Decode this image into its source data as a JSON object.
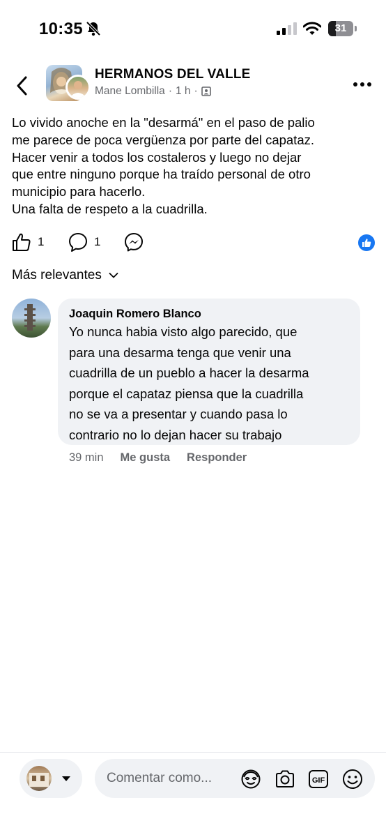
{
  "status_bar": {
    "time": "10:35",
    "battery": "31",
    "battery_fraction": 0.31
  },
  "header": {
    "group_name": "HERMANOS DEL VALLE",
    "author": "Mane Lombilla",
    "separator": "·",
    "time": "1 h"
  },
  "post": {
    "text": "Lo vivido anoche en la \"desarmá\" en el paso de palio\nme parece de poca vergüenza por parte del capataz.\nHacer venir a todos los costaleros y luego no dejar\nque entre ninguno porque ha traído personal de otro\nmunicipio para hacerlo.\nUna falta de respeto a la cuadrilla."
  },
  "actions": {
    "like_count": "1",
    "comment_count": "1"
  },
  "sort": {
    "label": "Más relevantes"
  },
  "comment": {
    "author": "Joaquin Romero Blanco",
    "text": "Yo nunca habia visto algo parecido, que\npara una desarma tenga que venir una\ncuadrilla de un pueblo a hacer la desarma\nporque el capataz piensa que la cuadrilla\nno se va a presentar y cuando pasa lo\ncontrario no lo dejan hacer su trabajo",
    "time": "39 min",
    "like_label": "Me gusta",
    "reply_label": "Responder"
  },
  "composer": {
    "placeholder": "Comentar como..."
  },
  "colors": {
    "accent": "#1877f2",
    "bubble": "#f0f2f5",
    "secondary_text": "#65676b"
  },
  "icons": [
    "mute-bell-icon",
    "signal-icon",
    "wifi-icon",
    "back-arrow-icon",
    "audience-icon",
    "more-icon",
    "like-icon",
    "comment-icon",
    "messenger-icon",
    "chevron-down-icon",
    "avatar-sticker-icon",
    "camera-icon",
    "gif-icon",
    "emoji-icon"
  ]
}
